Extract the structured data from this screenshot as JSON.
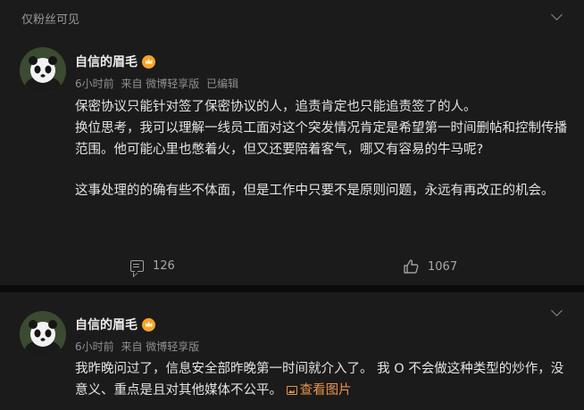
{
  "post1": {
    "visibility": "仅粉丝可见",
    "author": "自信的眉毛",
    "meta": {
      "time": "6小时前",
      "source": "来自 微博轻享版",
      "edited": "已编辑"
    },
    "paragraphs": [
      "保密协议只能针对签了保密协议的人，追责肯定也只能追责签了的人。",
      "换位思考，我可以理解一线员工面对这个突发情况肯定是希望第一时间删帖和控制传播范围。他可能心里也憋着火，但又还要陪着客气，哪又有容易的牛马呢?",
      "这事处理的的确有些不体面，但是工作中只要不是原则问题，永远有再改正的机会。"
    ],
    "comments": "126",
    "likes": "1067"
  },
  "post2": {
    "author": "自信的眉毛",
    "meta": {
      "time": "6小时前",
      "source": "来自 微博轻享版"
    },
    "text": "我昨晚问过了，信息安全部昨晚第一时间就介入了。 我 O 不会做这种类型的炒作，没意义、重点是且对其他媒体不公平。 ",
    "view_image": "查看图片"
  },
  "colors": {
    "background": "#1b1b1b",
    "accent": "#e8944a",
    "badge": "#f6a32a"
  },
  "icons": [
    "chevron-down-icon",
    "verified-badge-icon",
    "comment-icon",
    "like-icon",
    "image-icon"
  ]
}
